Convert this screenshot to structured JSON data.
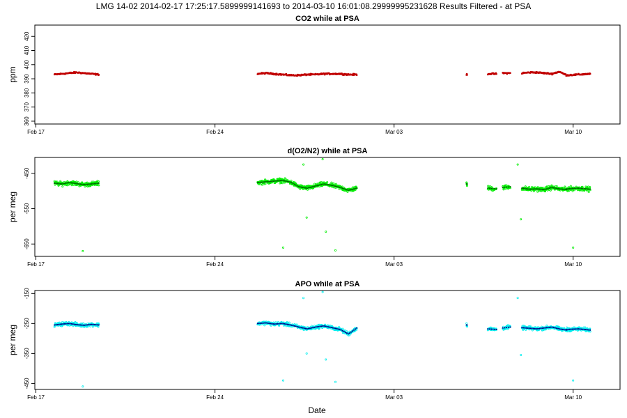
{
  "main_title": "LMG   14-02    2014-02-17 17:25:17.5899999141693 to 2014-03-10 16:01:08.29999995231628   Results Filtered - at PSA",
  "xlabel": "Date",
  "colors": {
    "co2_points": "#c00000",
    "o2n2_points": "#00ee00",
    "o2n2_smooth": "#006400",
    "apo_points": "#00eeee",
    "apo_smooth": "#00008b",
    "axis": "#000000"
  },
  "chart_data": [
    {
      "type": "scatter",
      "title": "CO2 while at PSA",
      "xlabel": "",
      "ylabel": "ppm",
      "x_ticks": [
        "Feb 17",
        "Feb 24",
        "Mar 03",
        "Mar 10"
      ],
      "xlim": [
        "2014-02-16T23:00",
        "2014-03-11T20:00"
      ],
      "y_ticks": [
        360,
        370,
        380,
        390,
        400,
        410,
        420
      ],
      "ylim": [
        358,
        428
      ],
      "grid": false,
      "segments": [
        {
          "start": "2014-02-17T17:25",
          "end": "2014-02-19T11:00",
          "values": [
            393,
            393.5,
            394,
            394.5,
            394,
            393.5,
            393
          ]
        },
        {
          "start": "2014-02-25T16:00",
          "end": "2014-03-01T13:00",
          "values": [
            393.5,
            394,
            393.5,
            393,
            392.5,
            392.5,
            393,
            393,
            393.5,
            393.5,
            393.5,
            393,
            393
          ]
        },
        {
          "start": "2014-03-05T20:00",
          "end": "2014-03-05T20:30",
          "values": [
            393
          ]
        },
        {
          "start": "2014-03-06T16:00",
          "end": "2014-03-07T00:00",
          "values": [
            393.5,
            393.5
          ]
        },
        {
          "start": "2014-03-07T06:00",
          "end": "2014-03-07T13:00",
          "values": [
            394,
            394
          ]
        },
        {
          "start": "2014-03-08T00:00",
          "end": "2014-03-09T18:00",
          "values": [
            394,
            394.5,
            394.5,
            394,
            393.5,
            395,
            392.5
          ]
        },
        {
          "start": "2014-03-09T18:00",
          "end": "2014-03-10T16:01",
          "values": [
            392.5,
            393,
            393.5
          ]
        }
      ]
    },
    {
      "type": "scatter",
      "title": "d(O2/N2) while at PSA",
      "xlabel": "",
      "ylabel": "per meg",
      "x_ticks": [
        "Feb 17",
        "Feb 24",
        "Mar 03",
        "Mar 10"
      ],
      "xlim": [
        "2014-02-16T23:00",
        "2014-03-11T20:00"
      ],
      "y_ticks": [
        -650,
        -550,
        -450
      ],
      "ylim": [
        -685,
        -405
      ],
      "grid": false,
      "segments": [
        {
          "start": "2014-02-17T17:25",
          "end": "2014-02-19T11:00",
          "values": [
            -478,
            -480,
            -476,
            -479,
            -482,
            -480,
            -478
          ]
        },
        {
          "start": "2014-02-25T16:00",
          "end": "2014-03-01T13:00",
          "values": [
            -476,
            -474,
            -472,
            -470,
            -475,
            -488,
            -492,
            -486,
            -480,
            -484,
            -490,
            -498,
            -492
          ]
        },
        {
          "start": "2014-03-05T20:00",
          "end": "2014-03-05T20:30",
          "values": [
            -480
          ]
        },
        {
          "start": "2014-03-06T16:00",
          "end": "2014-03-07T00:00",
          "values": [
            -492,
            -494
          ]
        },
        {
          "start": "2014-03-07T06:00",
          "end": "2014-03-07T13:00",
          "values": [
            -490,
            -488
          ]
        },
        {
          "start": "2014-03-08T00:00",
          "end": "2014-03-09T18:00",
          "values": [
            -492,
            -495,
            -494,
            -496,
            -490,
            -494,
            -496
          ]
        },
        {
          "start": "2014-03-09T18:00",
          "end": "2014-03-10T16:01",
          "values": [
            -494,
            -492,
            -495
          ]
        }
      ],
      "outliers": [
        {
          "x": "2014-02-18T20:00",
          "y": -670
        },
        {
          "x": "2014-02-26T16:00",
          "y": -660
        },
        {
          "x": "2014-02-27T11:00",
          "y": -425
        },
        {
          "x": "2014-02-27T14:00",
          "y": -575
        },
        {
          "x": "2014-02-28T05:00",
          "y": -410
        },
        {
          "x": "2014-02-28T08:00",
          "y": -615
        },
        {
          "x": "2014-02-28T17:00",
          "y": -668
        },
        {
          "x": "2014-03-07T20:00",
          "y": -425
        },
        {
          "x": "2014-03-07T23:00",
          "y": -580
        },
        {
          "x": "2014-03-10T00:00",
          "y": -660
        }
      ]
    },
    {
      "type": "scatter",
      "title": "APO while at PSA",
      "xlabel": "Date",
      "ylabel": "per meg",
      "x_ticks": [
        "Feb 17",
        "Feb 24",
        "Mar 03",
        "Mar 10"
      ],
      "xlim": [
        "2014-02-16T23:00",
        "2014-03-11T20:00"
      ],
      "y_ticks": [
        -450,
        -350,
        -250,
        -150
      ],
      "ylim": [
        -470,
        -140
      ],
      "grid": false,
      "segments": [
        {
          "start": "2014-02-17T17:25",
          "end": "2014-02-19T11:00",
          "values": [
            -255,
            -252,
            -250,
            -254,
            -256,
            -253,
            -255
          ]
        },
        {
          "start": "2014-02-25T16:00",
          "end": "2014-03-01T13:00",
          "values": [
            -250,
            -248,
            -252,
            -250,
            -255,
            -262,
            -268,
            -262,
            -258,
            -264,
            -270,
            -285,
            -265
          ]
        },
        {
          "start": "2014-03-05T20:00",
          "end": "2014-03-05T20:30",
          "values": [
            -255
          ]
        },
        {
          "start": "2014-03-06T16:00",
          "end": "2014-03-07T00:00",
          "values": [
            -268,
            -270
          ]
        },
        {
          "start": "2014-03-07T06:00",
          "end": "2014-03-07T13:00",
          "values": [
            -265,
            -262
          ]
        },
        {
          "start": "2014-03-08T00:00",
          "end": "2014-03-09T18:00",
          "values": [
            -264,
            -266,
            -268,
            -265,
            -262,
            -268,
            -272
          ]
        },
        {
          "start": "2014-03-09T18:00",
          "end": "2014-03-10T16:01",
          "values": [
            -270,
            -268,
            -272
          ]
        }
      ],
      "outliers": [
        {
          "x": "2014-02-18T20:00",
          "y": -460
        },
        {
          "x": "2014-02-26T16:00",
          "y": -440
        },
        {
          "x": "2014-02-27T11:00",
          "y": -165
        },
        {
          "x": "2014-02-27T14:00",
          "y": -350
        },
        {
          "x": "2014-02-28T05:00",
          "y": -145
        },
        {
          "x": "2014-02-28T08:00",
          "y": -370
        },
        {
          "x": "2014-02-28T17:00",
          "y": -445
        },
        {
          "x": "2014-03-07T20:00",
          "y": -165
        },
        {
          "x": "2014-03-07T23:00",
          "y": -355
        },
        {
          "x": "2014-03-10T00:00",
          "y": -440
        }
      ]
    }
  ]
}
